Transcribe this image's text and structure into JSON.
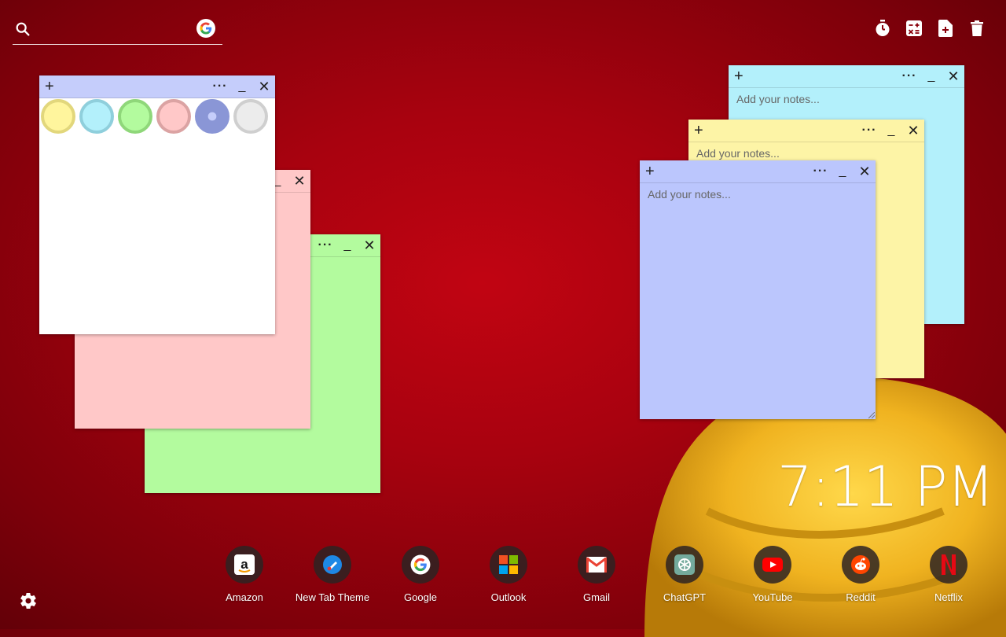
{
  "search": {
    "placeholder": "",
    "value": ""
  },
  "toolbar": {
    "icons": [
      "timer-icon",
      "calculator-icon",
      "new-note-icon",
      "trash-icon"
    ]
  },
  "notes": {
    "left": [
      {
        "name": "white-note",
        "color": "#ffffff",
        "bar_color": "#c5cdfb"
      },
      {
        "name": "pink-note",
        "color": "#ffc8c8"
      },
      {
        "name": "green-note",
        "color": "#b3fb9e"
      }
    ],
    "right": [
      {
        "name": "cyan-note",
        "color": "#b3f0fb",
        "placeholder": "Add your notes..."
      },
      {
        "name": "yellow-note",
        "color": "#fdf4a6",
        "placeholder": "Add your notes..."
      },
      {
        "name": "blue-note",
        "color": "#bbc6fd",
        "placeholder": "Add your notes..."
      }
    ],
    "swatches": [
      "#fff59d",
      "#b3f0fb",
      "#b3fb9e",
      "#ffc8c8",
      "#8a96d6",
      "#e8e8e8"
    ]
  },
  "clock": {
    "time": "7:11 PM"
  },
  "shortcuts": [
    {
      "label": "Amazon"
    },
    {
      "label": "New Tab Theme"
    },
    {
      "label": "Google"
    },
    {
      "label": "Outlook"
    },
    {
      "label": "Gmail"
    },
    {
      "label": "ChatGPT"
    },
    {
      "label": "YouTube"
    },
    {
      "label": "Reddit"
    },
    {
      "label": "Netflix"
    }
  ]
}
